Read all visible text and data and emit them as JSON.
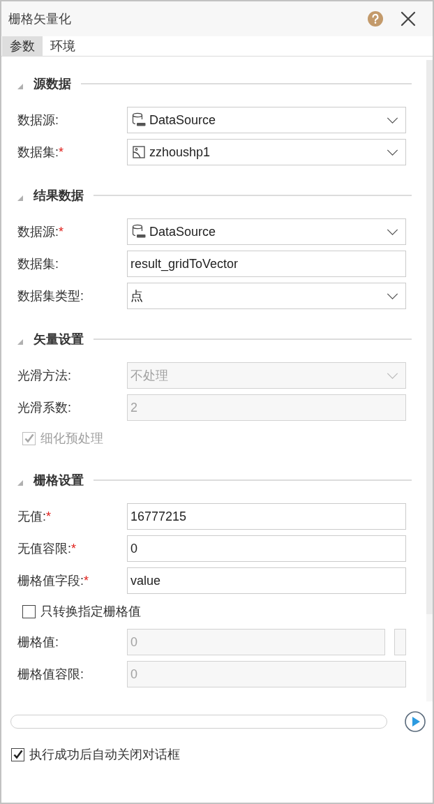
{
  "window": {
    "title": "栅格矢量化"
  },
  "tabs": [
    {
      "label": "参数",
      "selected": true
    },
    {
      "label": "环境",
      "selected": false
    }
  ],
  "sections": [
    {
      "title": "源数据",
      "expanded": true,
      "rows": [
        {
          "kind": "datasource",
          "label": "数据源:",
          "value": "DataSource",
          "disabled": false
        },
        {
          "kind": "dataset",
          "label": "数据集:",
          "required_mark": "*",
          "value": "zzhoushp1",
          "disabled": false
        }
      ]
    },
    {
      "title": "结果数据",
      "expanded": true,
      "rows": [
        {
          "kind": "datasource",
          "label": "数据源:",
          "required_mark": "*",
          "value": "DataSource",
          "disabled": false
        },
        {
          "kind": "text",
          "label": "数据集:",
          "value": "result_gridToVector",
          "disabled": false
        },
        {
          "kind": "select",
          "label": "数据集类型:",
          "value": "点",
          "disabled": false
        }
      ]
    },
    {
      "title": "矢量设置",
      "expanded": true,
      "rows": [
        {
          "kind": "select",
          "label": "光滑方法:",
          "value": "不处理",
          "disabled": true
        },
        {
          "kind": "text",
          "label": "光滑系数:",
          "value": "2",
          "disabled": true
        },
        {
          "kind": "checkbox",
          "label": "细化预处理",
          "checked": true,
          "disabled": true
        }
      ]
    },
    {
      "title": "栅格设置",
      "expanded": true,
      "rows": [
        {
          "kind": "text",
          "label": "无值:",
          "required_mark": "*",
          "value": "16777215",
          "disabled": false
        },
        {
          "kind": "text",
          "label": "无值容限:",
          "required_mark": "*",
          "value": "0",
          "disabled": false
        },
        {
          "kind": "text",
          "label": "栅格值字段:",
          "required_mark": "*",
          "value": "value",
          "disabled": false
        },
        {
          "kind": "checkbox",
          "label": "只转换指定栅格值",
          "checked": false,
          "disabled": false
        },
        {
          "kind": "text-button",
          "label": "栅格值:",
          "value": "0",
          "disabled": true
        },
        {
          "kind": "text",
          "label": "栅格值容限:",
          "value": "0",
          "disabled": true
        }
      ]
    }
  ],
  "progress": {
    "level": 0
  },
  "auto_close": {
    "label": "执行成功后自动关闭对话框",
    "checked": true
  }
}
